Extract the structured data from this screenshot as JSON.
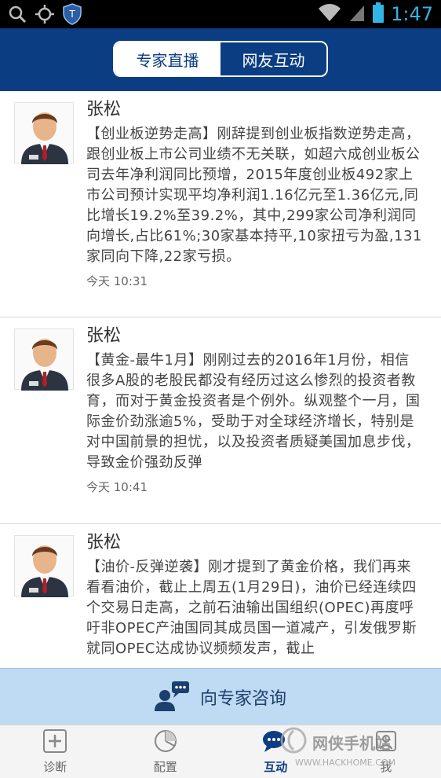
{
  "status_bar": {
    "time": "1:47",
    "icons": [
      "search-icon",
      "gps-icon",
      "shield-icon",
      "wifi-icon",
      "signal-icon",
      "battery-icon"
    ],
    "accent_color": "#32b5e5"
  },
  "header": {
    "background": "#0b3d82",
    "tabs": [
      {
        "label": "专家直播",
        "active": true
      },
      {
        "label": "网友互动",
        "active": false
      }
    ]
  },
  "posts": [
    {
      "author": "张松",
      "content": "【创业板逆势走高】刚辞提到创业板指数逆势走高，跟创业板上市公司业绩不无关联，如超六成创业板公司去年净利润同比预增，2015年度创业板492家上市公司预计实现平均净利润1.16亿元至1.36亿元,同比增长19.2%至39.2%，其中,299家公司净利润同向增长,占比61%;30家基本持平,10家扭亏为盈,131家同向下降,22家亏损。",
      "time": "今天 10:31"
    },
    {
      "author": "张松",
      "content": "【黄金-最牛1月】刚刚过去的2016年1月份，相信很多A股的老股民都没有经历过这么惨烈的投资者教育，而对于黄金投资者是个例外。纵观整个一月，国际金价劲涨逾5%，受助于对全球经济增长，特别是对中国前景的担忧，以及投资者质疑美国加息步伐，导致金价强劲反弹",
      "time": "今天 10:41"
    },
    {
      "author": "张松",
      "content": "【油价-反弹逆袭】刚才提到了黄金价格，我们再来看看油价，截止上周五(1月29日)，油价已经连续四个交易日走高，之前石油输出国组织(OPEC)再度呼吁非OPEC产油国同其成员国一道减产，引发俄罗斯就同OPEC达成协议频频发声，截止",
      "time": ""
    }
  ],
  "consult": {
    "label": "向专家咨询",
    "icon": "chat-user-icon"
  },
  "tabbar": {
    "items": [
      {
        "label": "诊断",
        "icon": "plus-box-icon",
        "active": false
      },
      {
        "label": "配置",
        "icon": "pie-chart-icon",
        "active": false
      },
      {
        "label": "互动",
        "icon": "chat-bubble-icon",
        "active": true
      },
      {
        "label": "我",
        "icon": "person-icon",
        "active": false
      }
    ]
  },
  "watermark": {
    "title": "网侠手机站",
    "url": "WWW.HACKHOME.COM"
  }
}
